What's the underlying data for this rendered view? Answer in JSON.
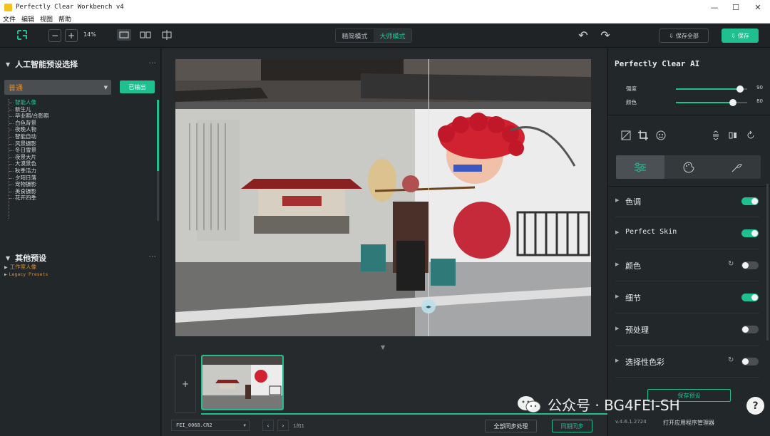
{
  "window": {
    "title": "Perfectly Clear Workbench v4",
    "min": "—",
    "max": "☐",
    "close": "✕"
  },
  "menu": [
    "文件",
    "编辑",
    "视图",
    "帮助"
  ],
  "toolbar": {
    "zoom_out": "−",
    "zoom_in": "+",
    "zoom_level": "14%",
    "mode_simple": "精简模式",
    "mode_master": "大师模式",
    "undo": "↶",
    "redo": "↷",
    "save_all": "保存全部",
    "save": "保存"
  },
  "left_panel": {
    "ai_presets_title": "人工智能预设选择",
    "dots": "···",
    "selected_preset": "普通",
    "select_button": "已输出",
    "presets": [
      "智能人像",
      "新生儿",
      "毕业照/合影照",
      "白色背景",
      "夜晚人物",
      "智能自动",
      "风景摄影",
      "冬日雪景",
      "夜景大片",
      "大漠景色",
      "秋季活力",
      "夕阳日落",
      "宠物摄影",
      "美食摄影",
      "花开四季"
    ],
    "other_presets_title": "其他预设",
    "other_presets": [
      "工作室人像",
      "Legacy Presets"
    ]
  },
  "center": {
    "file_name": "FEI_0068.CR2",
    "prev": "‹",
    "next": "›",
    "page_indicator": "1的1",
    "sync_all": "全部同步处理",
    "sync_one": "同期同步",
    "add_tile": "+",
    "down_caret": "▼"
  },
  "right_panel": {
    "title": "Perfectly Clear AI",
    "sliders": [
      {
        "label": "强度",
        "value": 90,
        "display": "90"
      },
      {
        "label": "颜色",
        "value": 80,
        "display": "80"
      }
    ],
    "adjustments": [
      {
        "name": "色调",
        "enabled": true,
        "resettable": false,
        "mono": false
      },
      {
        "name": "Perfect Skin",
        "enabled": true,
        "resettable": false,
        "mono": true
      },
      {
        "name": "颜色",
        "enabled": false,
        "resettable": true,
        "mono": false
      },
      {
        "name": "细节",
        "enabled": true,
        "resettable": false,
        "mono": false
      },
      {
        "name": "预处理",
        "enabled": false,
        "resettable": false,
        "mono": false
      },
      {
        "name": "选择性色彩",
        "enabled": false,
        "resettable": true,
        "mono": false
      }
    ],
    "save_preset": "保存预设",
    "version": "v.4.6.1.2724",
    "open_manager": "打开应用程序管理器"
  },
  "watermark": {
    "text": "公众号 · BG4FEI-SH"
  },
  "help": "?",
  "colors": {
    "accent": "#1fbf8f",
    "bg": "#1f2326",
    "panel": "#22272a",
    "preset_orange": "#e08a2c"
  }
}
